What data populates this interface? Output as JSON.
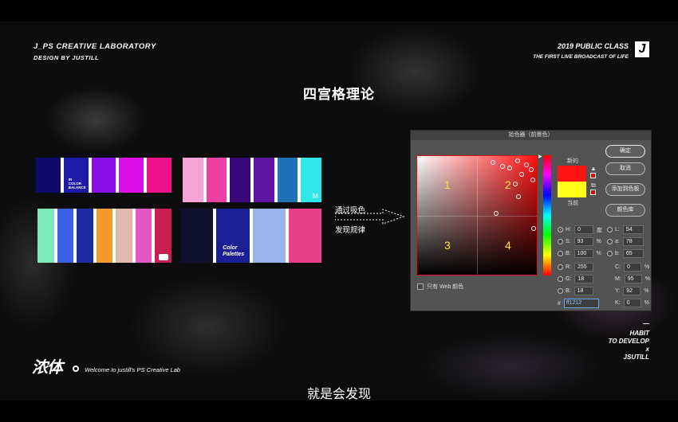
{
  "header": {
    "left_line1": "J_PS  CREATIVE LABORATORY",
    "left_line2": "DESIGN  BY JUSTILL",
    "right_line1": "2019 PUBLIC CLASS",
    "right_line2": "THE FIRST LIVE BROADCAST OF LIFE",
    "logo": "J"
  },
  "slide_title": "四宫格理论",
  "palettes": {
    "p1": {
      "colors": [
        "#0e0a6b",
        "#1d1aa8",
        "#8a10e8",
        "#d910e6",
        "#ee1388"
      ],
      "label": "IN\nCOLOR\nBALANCE"
    },
    "p2": {
      "colors": [
        "#f5a3d4",
        "#ee3fa3",
        "#3a0a7a",
        "#5e14a0",
        "#1e73b8",
        "#2fe6e8"
      ],
      "label": "M"
    },
    "p3": {
      "colors": [
        "#7ee8b8",
        "#3b5fe0",
        "#1e2aa0",
        "#f29a2a",
        "#e3b8b0",
        "#e455c8",
        "#c81e52"
      ]
    },
    "p4": {
      "colors": [
        "#0f1030",
        "#1c1e96",
        "#98b4ea",
        "#e8418a"
      ],
      "label": "Color\nPalettes"
    }
  },
  "annotation": {
    "line1": "通过吸色",
    "line2": "发现规律"
  },
  "picker": {
    "title": "拾色器（前景色）",
    "new_label": "新的",
    "current_label": "当前",
    "buttons": {
      "ok": "确定",
      "cancel": "取消",
      "add_swatch": "添加到色板",
      "library": "颜色库"
    },
    "quadrants": [
      "1",
      "2",
      "3",
      "4"
    ],
    "web_only": "只有 Web 颜色",
    "hsb": [
      {
        "label": "H:",
        "value": "0",
        "unit": "度"
      },
      {
        "label": "S:",
        "value": "93",
        "unit": "%"
      },
      {
        "label": "B:",
        "value": "100",
        "unit": "%"
      }
    ],
    "lab": [
      {
        "label": "L:",
        "value": "54"
      },
      {
        "label": "a:",
        "value": "78"
      },
      {
        "label": "b:",
        "value": "65"
      }
    ],
    "rgb": [
      {
        "label": "R:",
        "value": "255"
      },
      {
        "label": "G:",
        "value": "18"
      },
      {
        "label": "B:",
        "value": "18"
      }
    ],
    "cmyk": [
      {
        "label": "C:",
        "value": "0",
        "unit": "%"
      },
      {
        "label": "M:",
        "value": "95",
        "unit": "%"
      },
      {
        "label": "Y:",
        "value": "92",
        "unit": "%"
      },
      {
        "label": "K:",
        "value": "0",
        "unit": "%"
      }
    ],
    "hex_label": "#",
    "hex_value": "ff1212",
    "new_color": "#ff1212",
    "current_color": "#ffff1a"
  },
  "footer": {
    "logo_text": "浓体",
    "welcome": "Welcome to justill's PS Creative Lab",
    "habit": [
      "—",
      "HABIT",
      "TO DEVELOP",
      "x",
      "JSUTILL"
    ]
  },
  "subtitle": "就是会发现"
}
